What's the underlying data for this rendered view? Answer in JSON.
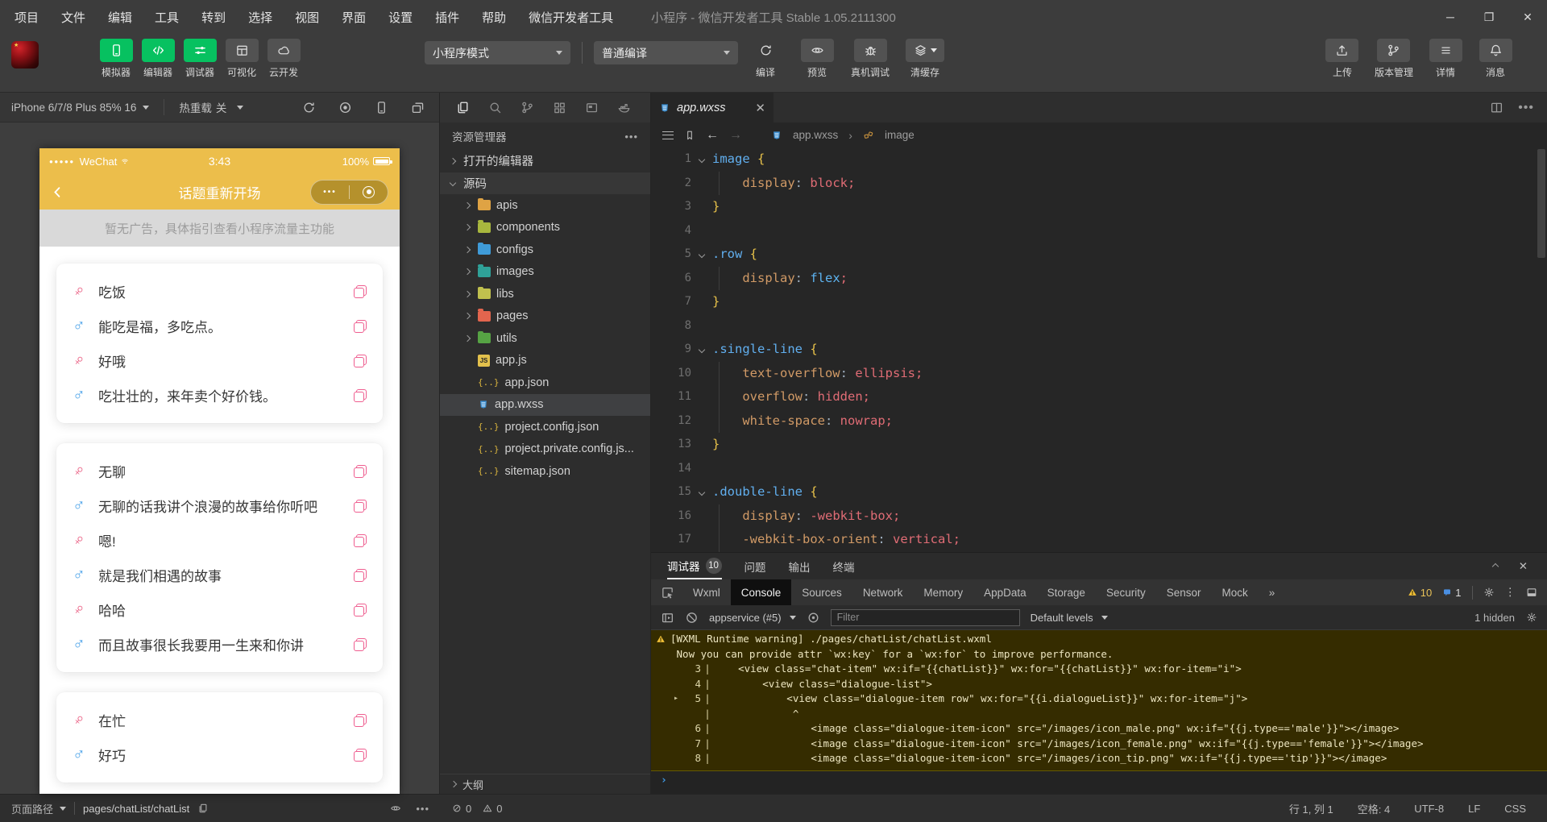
{
  "window": {
    "menus": [
      "项目",
      "文件",
      "编辑",
      "工具",
      "转到",
      "选择",
      "视图",
      "界面",
      "设置",
      "插件",
      "帮助",
      "微信开发者工具"
    ],
    "title": "小程序 - 微信开发者工具 Stable 1.05.2111300"
  },
  "toolbar": {
    "mode_buttons": [
      {
        "label": "模拟器",
        "icon": "phone",
        "active": true
      },
      {
        "label": "编辑器",
        "icon": "code",
        "active": true
      },
      {
        "label": "调试器",
        "icon": "sliders",
        "active": true
      },
      {
        "label": "可视化",
        "icon": "layout",
        "active": false
      },
      {
        "label": "云开发",
        "icon": "cloud",
        "active": false
      }
    ],
    "mode_select": "小程序模式",
    "compile_select": "普通编译",
    "action_buttons": [
      {
        "label": "编译",
        "icon": "refresh",
        "flat": true
      },
      {
        "label": "预览",
        "icon": "eye"
      },
      {
        "label": "真机调试",
        "icon": "bug"
      },
      {
        "label": "清缓存",
        "icon": "layers",
        "dropdown": true
      }
    ],
    "right_buttons": [
      {
        "label": "上传",
        "icon": "upload"
      },
      {
        "label": "版本管理",
        "icon": "branch"
      },
      {
        "label": "详情",
        "icon": "list"
      },
      {
        "label": "消息",
        "icon": "bell"
      }
    ]
  },
  "simulator": {
    "device": "iPhone 6/7/8 Plus 85% 16",
    "hot_reload_label": "热重载",
    "hot_reload_state": "关",
    "phone": {
      "carrier": "WeChat",
      "time": "3:43",
      "battery": "100%",
      "nav_title": "话题重新开场",
      "ad_banner": "暂无广告，具体指引查看小程序流量主功能",
      "chat_cards": [
        {
          "messages": [
            {
              "gender": "female",
              "text": "吃饭"
            },
            {
              "gender": "male",
              "text": "能吃是福，多吃点。"
            },
            {
              "gender": "female",
              "text": "好哦"
            },
            {
              "gender": "male",
              "text": "吃壮壮的，来年卖个好价钱。"
            }
          ]
        },
        {
          "messages": [
            {
              "gender": "female",
              "text": "无聊"
            },
            {
              "gender": "male",
              "text": "无聊的话我讲个浪漫的故事给你听吧"
            },
            {
              "gender": "female",
              "text": "嗯!"
            },
            {
              "gender": "male",
              "text": "就是我们相遇的故事"
            },
            {
              "gender": "female",
              "text": "哈哈"
            },
            {
              "gender": "male",
              "text": "而且故事很长我要用一生来和你讲"
            }
          ]
        },
        {
          "messages": [
            {
              "gender": "female",
              "text": "在忙"
            },
            {
              "gender": "male",
              "text": "好巧"
            }
          ]
        }
      ]
    }
  },
  "explorer": {
    "title": "资源管理器",
    "tree": [
      {
        "kind": "section",
        "label": "打开的编辑器",
        "chev": "right"
      },
      {
        "kind": "section",
        "label": "源码",
        "chev": "down",
        "src": true
      },
      {
        "kind": "folder",
        "label": "apis",
        "color": "#dfa344"
      },
      {
        "kind": "folder",
        "label": "components",
        "color": "#a8b73e"
      },
      {
        "kind": "folder",
        "label": "configs",
        "color": "#3f9bd8"
      },
      {
        "kind": "folder",
        "label": "images",
        "color": "#2fa198"
      },
      {
        "kind": "folder",
        "label": "libs",
        "color": "#c0c04e"
      },
      {
        "kind": "folder",
        "label": "pages",
        "color": "#e2654e"
      },
      {
        "kind": "folder",
        "label": "utils",
        "color": "#56a344"
      },
      {
        "kind": "file",
        "icon": "js",
        "label": "app.js"
      },
      {
        "kind": "file",
        "icon": "json",
        "label": "app.json"
      },
      {
        "kind": "file",
        "icon": "wxss",
        "label": "app.wxss",
        "selected": true
      },
      {
        "kind": "file",
        "icon": "json",
        "label": "project.config.json"
      },
      {
        "kind": "file",
        "icon": "json",
        "label": "project.private.config.js..."
      },
      {
        "kind": "file",
        "icon": "json",
        "label": "sitemap.json"
      }
    ],
    "outline": "大纲"
  },
  "editor": {
    "tab": "app.wxss",
    "breadcrumb": [
      "app.wxss",
      "image"
    ],
    "code_lines": [
      {
        "n": 1,
        "fold": true,
        "tokens": [
          [
            "sel",
            "image"
          ],
          [
            "pln",
            " "
          ],
          [
            "brc",
            "{"
          ]
        ]
      },
      {
        "n": 2,
        "guide": true,
        "tokens": [
          [
            "pln",
            "    "
          ],
          [
            "prp",
            "display"
          ],
          [
            "pun",
            ":"
          ],
          [
            "pln",
            " "
          ],
          [
            "val",
            "block"
          ],
          [
            "sem",
            ";"
          ]
        ]
      },
      {
        "n": 3,
        "tokens": [
          [
            "brc",
            "}"
          ]
        ]
      },
      {
        "n": 4,
        "tokens": []
      },
      {
        "n": 5,
        "fold": true,
        "tokens": [
          [
            "sel",
            ".row"
          ],
          [
            "pln",
            " "
          ],
          [
            "brc",
            "{"
          ]
        ]
      },
      {
        "n": 6,
        "guide": true,
        "tokens": [
          [
            "pln",
            "    "
          ],
          [
            "prp",
            "display"
          ],
          [
            "pun",
            ":"
          ],
          [
            "pln",
            " "
          ],
          [
            "kwd",
            "flex"
          ],
          [
            "sem",
            ";"
          ]
        ]
      },
      {
        "n": 7,
        "tokens": [
          [
            "brc",
            "}"
          ]
        ]
      },
      {
        "n": 8,
        "tokens": []
      },
      {
        "n": 9,
        "fold": true,
        "tokens": [
          [
            "sel",
            ".single-line"
          ],
          [
            "pln",
            " "
          ],
          [
            "brc",
            "{"
          ]
        ]
      },
      {
        "n": 10,
        "guide": true,
        "tokens": [
          [
            "pln",
            "    "
          ],
          [
            "prp",
            "text-overflow"
          ],
          [
            "pun",
            ":"
          ],
          [
            "pln",
            " "
          ],
          [
            "val",
            "ellipsis"
          ],
          [
            "sem",
            ";"
          ]
        ]
      },
      {
        "n": 11,
        "guide": true,
        "tokens": [
          [
            "pln",
            "    "
          ],
          [
            "prp",
            "overflow"
          ],
          [
            "pun",
            ":"
          ],
          [
            "pln",
            " "
          ],
          [
            "val",
            "hidden"
          ],
          [
            "sem",
            ";"
          ]
        ]
      },
      {
        "n": 12,
        "guide": true,
        "tokens": [
          [
            "pln",
            "    "
          ],
          [
            "prp",
            "white-space"
          ],
          [
            "pun",
            ":"
          ],
          [
            "pln",
            " "
          ],
          [
            "val",
            "nowrap"
          ],
          [
            "sem",
            ";"
          ]
        ]
      },
      {
        "n": 13,
        "tokens": [
          [
            "brc",
            "}"
          ]
        ]
      },
      {
        "n": 14,
        "tokens": []
      },
      {
        "n": 15,
        "fold": true,
        "tokens": [
          [
            "sel",
            ".double-line"
          ],
          [
            "pln",
            " "
          ],
          [
            "brc",
            "{"
          ]
        ]
      },
      {
        "n": 16,
        "guide": true,
        "tokens": [
          [
            "pln",
            "    "
          ],
          [
            "prp",
            "display"
          ],
          [
            "pun",
            ":"
          ],
          [
            "pln",
            " "
          ],
          [
            "val",
            "-webkit-box"
          ],
          [
            "sem",
            ";"
          ]
        ]
      },
      {
        "n": 17,
        "guide": true,
        "tokens": [
          [
            "pln",
            "    "
          ],
          [
            "prp",
            "-webkit-box-orient"
          ],
          [
            "pun",
            ":"
          ],
          [
            "pln",
            " "
          ],
          [
            "val",
            "vertical"
          ],
          [
            "sem",
            ";"
          ]
        ]
      }
    ]
  },
  "debugger": {
    "panel_tabs": [
      {
        "label": "调试器",
        "badge": "10",
        "active": true
      },
      {
        "label": "问题"
      },
      {
        "label": "输出"
      },
      {
        "label": "终端"
      }
    ],
    "devtools_tabs": [
      {
        "label": "Wxml"
      },
      {
        "label": "Console",
        "active": true
      },
      {
        "label": "Sources"
      },
      {
        "label": "Network"
      },
      {
        "label": "Memory"
      },
      {
        "label": "AppData"
      },
      {
        "label": "Storage"
      },
      {
        "label": "Security"
      },
      {
        "label": "Sensor"
      },
      {
        "label": "Mock"
      }
    ],
    "warnings_count": "10",
    "messages_count": "1",
    "console": {
      "context": "appservice (#5)",
      "filter_placeholder": "Filter",
      "levels": "Default levels",
      "hidden_label": "1 hidden",
      "log_lines": [
        {
          "w": true,
          "t": "[WXML Runtime warning] ./pages/chatList/chatList.wxml"
        },
        {
          "t": " Now you can provide attr `wx:key` for a `wx:for` to improve performance."
        },
        {
          "g": "3",
          "t": "    <view class=\"chat-item\" wx:if=\"{{chatList}}\" wx:for=\"{{chatList}}\" wx:for-item=\"i\">"
        },
        {
          "g": "4",
          "t": "        <view class=\"dialogue-list\">"
        },
        {
          "g": "5",
          "a": true,
          "t": "            <view class=\"dialogue-item row\" wx:for=\"{{i.dialogueList}}\" wx:for-item=\"j\">"
        },
        {
          "g": "",
          "t": "             ^"
        },
        {
          "g": "6",
          "t": "                <image class=\"dialogue-item-icon\" src=\"/images/icon_male.png\" wx:if=\"{{j.type=='male'}}\"></image>"
        },
        {
          "g": "7",
          "t": "                <image class=\"dialogue-item-icon\" src=\"/images/icon_female.png\" wx:if=\"{{j.type=='female'}}\"></image>"
        },
        {
          "g": "8",
          "t": "                <image class=\"dialogue-item-icon\" src=\"/images/icon_tip.png\" wx:if=\"{{j.type=='tip'}}\"></image>"
        }
      ]
    }
  },
  "statusbar": {
    "page_path_label": "页面路径",
    "page_path": "pages/chatList/chatList",
    "errors": "0",
    "warnings": "0",
    "right_items": [
      "行 1, 列 1",
      "空格: 4",
      "UTF-8",
      "LF",
      "CSS"
    ]
  },
  "colors": {
    "brand_green": "#07c160",
    "wechat_yellow": "#ecbe4b",
    "female_pink": "#ea5d82",
    "male_blue": "#54a7ea",
    "warning_yellow": "#f2c037"
  }
}
